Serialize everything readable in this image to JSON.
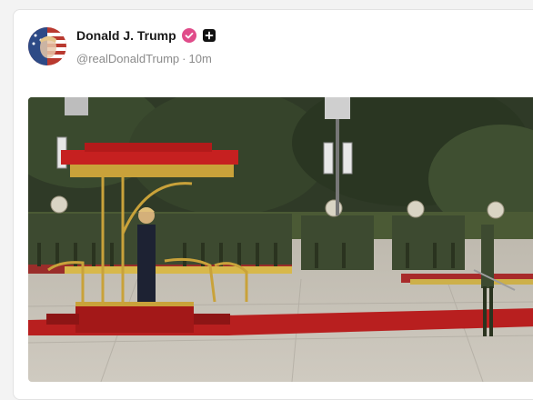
{
  "post": {
    "author": {
      "display_name": "Donald J. Trump",
      "handle": "@realDonaldTrump",
      "separator": "·",
      "time_ago": "10m",
      "verified_icon": "verified-badge-icon",
      "plus_icon": "plus-badge-icon"
    },
    "media": {
      "kind": "photo",
      "subject": "military-honor-guard-ceremony"
    }
  },
  "colors": {
    "badge": "#e04c8a",
    "carpet": "#b81f1f",
    "canopy": "#c62020",
    "gold": "#c9a23a",
    "uniform": "#3d4a30"
  }
}
